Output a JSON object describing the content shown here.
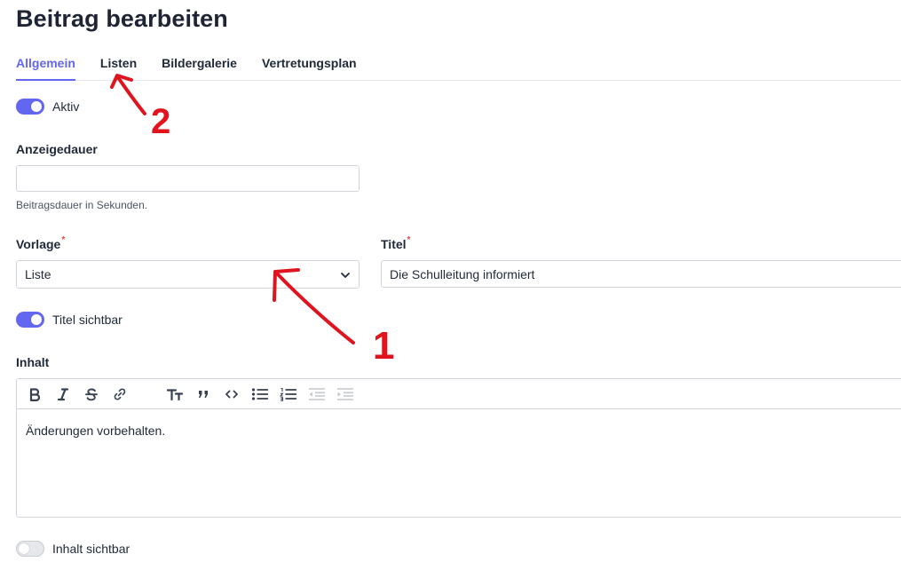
{
  "page": {
    "title": "Beitrag bearbeiten"
  },
  "tabs": [
    {
      "label": "Allgemein",
      "active": true
    },
    {
      "label": "Listen",
      "active": false
    },
    {
      "label": "Bildergalerie",
      "active": false
    },
    {
      "label": "Vertretungsplan",
      "active": false
    }
  ],
  "aktiv": {
    "label": "Aktiv",
    "checked": true
  },
  "anzeigedauer": {
    "label": "Anzeigedauer",
    "value": "",
    "hint": "Beitragsdauer in Sekunden."
  },
  "vorlage": {
    "label": "Vorlage",
    "required_mark": "*",
    "value": "Liste"
  },
  "titel": {
    "label": "Titel",
    "required_mark": "*",
    "value": "Die Schulleitung informiert"
  },
  "titel_sichtbar": {
    "label": "Titel sichtbar",
    "checked": true
  },
  "inhalt": {
    "label": "Inhalt",
    "content": "Änderungen vorbehalten.",
    "toolbar": [
      "bold-icon",
      "italic-icon",
      "strikethrough-icon",
      "link-icon",
      "heading-icon",
      "quote-icon",
      "code-icon",
      "bullet-list-icon",
      "numbered-list-icon",
      "outdent-icon",
      "indent-icon"
    ]
  },
  "inhalt_sichtbar": {
    "label": "Inhalt sichtbar",
    "checked": false
  },
  "annotations": {
    "arrow_1": "1",
    "arrow_2": "2",
    "color": "#e0141e"
  },
  "colors": {
    "accent": "#6366f1",
    "required": "#ef4444",
    "annotation": "#e0141e"
  }
}
